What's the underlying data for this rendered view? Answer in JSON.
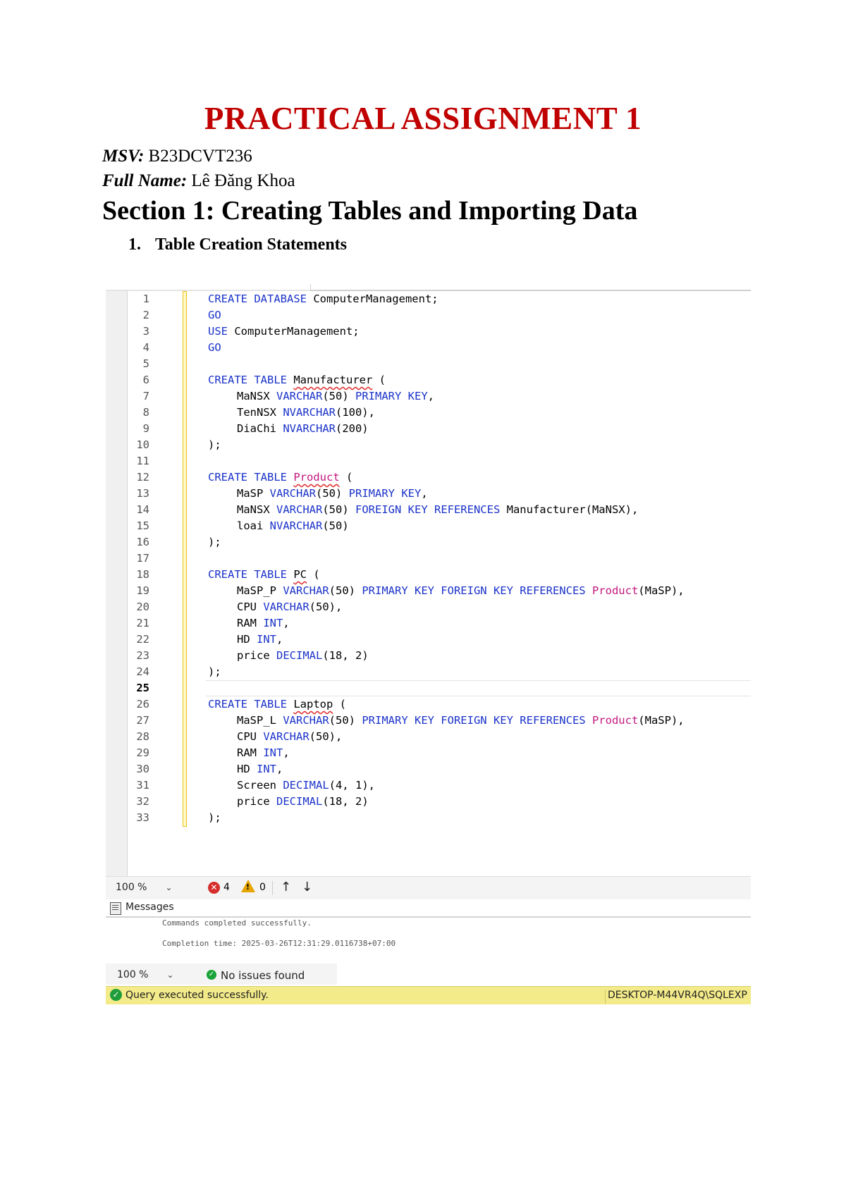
{
  "document": {
    "title": "PRACTICAL ASSIGNMENT 1",
    "msv_label": "MSV:",
    "msv_value": "B23DCVT236",
    "name_label": "Full Name:",
    "name_value": "Lê Đăng Khoa",
    "section_heading": "Section 1: Creating Tables and Importing Data",
    "list_number": "1.",
    "list_item": "Table Creation Statements"
  },
  "editor": {
    "current_line": 25,
    "lines": [
      {
        "n": "1",
        "indent": false,
        "tokens": [
          {
            "t": "CREATE DATABASE",
            "c": "kw"
          },
          {
            "t": " ComputerManagement;",
            "c": ""
          }
        ]
      },
      {
        "n": "2",
        "indent": false,
        "tokens": [
          {
            "t": "GO",
            "c": "kw"
          }
        ]
      },
      {
        "n": "3",
        "indent": false,
        "tokens": [
          {
            "t": "USE",
            "c": "kw"
          },
          {
            "t": " ComputerManagement;",
            "c": ""
          }
        ]
      },
      {
        "n": "4",
        "indent": false,
        "tokens": [
          {
            "t": "GO",
            "c": "kw"
          }
        ]
      },
      {
        "n": "5",
        "indent": false,
        "tokens": []
      },
      {
        "n": "6",
        "indent": false,
        "tokens": [
          {
            "t": "CREATE TABLE",
            "c": "kw"
          },
          {
            "t": " ",
            "c": ""
          },
          {
            "t": "Manufacturer",
            "c": "sq"
          },
          {
            "t": " (",
            "c": ""
          }
        ]
      },
      {
        "n": "7",
        "indent": true,
        "tokens": [
          {
            "t": "MaNSX ",
            "c": ""
          },
          {
            "t": "VARCHAR",
            "c": "kw"
          },
          {
            "t": "(50) ",
            "c": ""
          },
          {
            "t": "PRIMARY KEY",
            "c": "kw"
          },
          {
            "t": ",",
            "c": ""
          }
        ]
      },
      {
        "n": "8",
        "indent": true,
        "tokens": [
          {
            "t": "TenNSX ",
            "c": ""
          },
          {
            "t": "NVARCHAR",
            "c": "kw"
          },
          {
            "t": "(100),",
            "c": ""
          }
        ]
      },
      {
        "n": "9",
        "indent": true,
        "tokens": [
          {
            "t": "DiaChi ",
            "c": ""
          },
          {
            "t": "NVARCHAR",
            "c": "kw"
          },
          {
            "t": "(200)",
            "c": ""
          }
        ]
      },
      {
        "n": "10",
        "indent": false,
        "tokens": [
          {
            "t": ");",
            "c": ""
          }
        ]
      },
      {
        "n": "11",
        "indent": false,
        "tokens": []
      },
      {
        "n": "12",
        "indent": false,
        "tokens": [
          {
            "t": "CREATE TABLE",
            "c": "kw"
          },
          {
            "t": " ",
            "c": ""
          },
          {
            "t": "Product",
            "c": "fn sq"
          },
          {
            "t": " (",
            "c": ""
          }
        ]
      },
      {
        "n": "13",
        "indent": true,
        "tokens": [
          {
            "t": "MaSP ",
            "c": ""
          },
          {
            "t": "VARCHAR",
            "c": "kw"
          },
          {
            "t": "(50) ",
            "c": ""
          },
          {
            "t": "PRIMARY KEY",
            "c": "kw"
          },
          {
            "t": ",",
            "c": ""
          }
        ]
      },
      {
        "n": "14",
        "indent": true,
        "tokens": [
          {
            "t": "MaNSX ",
            "c": ""
          },
          {
            "t": "VARCHAR",
            "c": "kw"
          },
          {
            "t": "(50) ",
            "c": ""
          },
          {
            "t": "FOREIGN KEY REFERENCES",
            "c": "kw"
          },
          {
            "t": " Manufacturer(MaNSX),",
            "c": ""
          }
        ]
      },
      {
        "n": "15",
        "indent": true,
        "tokens": [
          {
            "t": "loai ",
            "c": ""
          },
          {
            "t": "NVARCHAR",
            "c": "kw"
          },
          {
            "t": "(50)",
            "c": ""
          }
        ]
      },
      {
        "n": "16",
        "indent": false,
        "tokens": [
          {
            "t": ");",
            "c": ""
          }
        ]
      },
      {
        "n": "17",
        "indent": false,
        "tokens": []
      },
      {
        "n": "18",
        "indent": false,
        "tokens": [
          {
            "t": "CREATE TABLE",
            "c": "kw"
          },
          {
            "t": " ",
            "c": ""
          },
          {
            "t": "PC",
            "c": "sq"
          },
          {
            "t": " (",
            "c": ""
          }
        ]
      },
      {
        "n": "19",
        "indent": true,
        "tokens": [
          {
            "t": "MaSP_P ",
            "c": ""
          },
          {
            "t": "VARCHAR",
            "c": "kw"
          },
          {
            "t": "(50) ",
            "c": ""
          },
          {
            "t": "PRIMARY KEY FOREIGN KEY REFERENCES",
            "c": "kw"
          },
          {
            "t": " ",
            "c": ""
          },
          {
            "t": "Product",
            "c": "fn"
          },
          {
            "t": "(MaSP),",
            "c": ""
          }
        ]
      },
      {
        "n": "20",
        "indent": true,
        "tokens": [
          {
            "t": "CPU ",
            "c": ""
          },
          {
            "t": "VARCHAR",
            "c": "kw"
          },
          {
            "t": "(50),",
            "c": ""
          }
        ]
      },
      {
        "n": "21",
        "indent": true,
        "tokens": [
          {
            "t": "RAM ",
            "c": ""
          },
          {
            "t": "INT",
            "c": "kw"
          },
          {
            "t": ",",
            "c": ""
          }
        ]
      },
      {
        "n": "22",
        "indent": true,
        "tokens": [
          {
            "t": "HD ",
            "c": ""
          },
          {
            "t": "INT",
            "c": "kw"
          },
          {
            "t": ",",
            "c": ""
          }
        ]
      },
      {
        "n": "23",
        "indent": true,
        "tokens": [
          {
            "t": "price ",
            "c": ""
          },
          {
            "t": "DECIMAL",
            "c": "kw"
          },
          {
            "t": "(18, 2)",
            "c": ""
          }
        ]
      },
      {
        "n": "24",
        "indent": false,
        "tokens": [
          {
            "t": ");",
            "c": ""
          }
        ]
      },
      {
        "n": "25",
        "indent": false,
        "tokens": []
      },
      {
        "n": "26",
        "indent": false,
        "tokens": [
          {
            "t": "CREATE TABLE",
            "c": "kw"
          },
          {
            "t": " ",
            "c": ""
          },
          {
            "t": "Laptop",
            "c": "sq"
          },
          {
            "t": " (",
            "c": ""
          }
        ]
      },
      {
        "n": "27",
        "indent": true,
        "tokens": [
          {
            "t": "MaSP_L ",
            "c": ""
          },
          {
            "t": "VARCHAR",
            "c": "kw"
          },
          {
            "t": "(50) ",
            "c": ""
          },
          {
            "t": "PRIMARY KEY FOREIGN KEY REFERENCES",
            "c": "kw"
          },
          {
            "t": " ",
            "c": ""
          },
          {
            "t": "Product",
            "c": "fn"
          },
          {
            "t": "(MaSP),",
            "c": ""
          }
        ]
      },
      {
        "n": "28",
        "indent": true,
        "tokens": [
          {
            "t": "CPU ",
            "c": ""
          },
          {
            "t": "VARCHAR",
            "c": "kw"
          },
          {
            "t": "(50),",
            "c": ""
          }
        ]
      },
      {
        "n": "29",
        "indent": true,
        "tokens": [
          {
            "t": "RAM ",
            "c": ""
          },
          {
            "t": "INT",
            "c": "kw"
          },
          {
            "t": ",",
            "c": ""
          }
        ]
      },
      {
        "n": "30",
        "indent": true,
        "tokens": [
          {
            "t": "HD ",
            "c": ""
          },
          {
            "t": "INT",
            "c": "kw"
          },
          {
            "t": ",",
            "c": ""
          }
        ]
      },
      {
        "n": "31",
        "indent": true,
        "tokens": [
          {
            "t": "Screen ",
            "c": ""
          },
          {
            "t": "DECIMAL",
            "c": "kw"
          },
          {
            "t": "(4, 1),",
            "c": ""
          }
        ]
      },
      {
        "n": "32",
        "indent": true,
        "tokens": [
          {
            "t": "price ",
            "c": ""
          },
          {
            "t": "DECIMAL",
            "c": "kw"
          },
          {
            "t": "(18, 2)",
            "c": ""
          }
        ]
      },
      {
        "n": "33",
        "indent": false,
        "tokens": [
          {
            "t": ");",
            "c": ""
          }
        ]
      }
    ]
  },
  "toolbar": {
    "zoom": "100 %",
    "errors": "4",
    "warnings": "0",
    "up_arrow": "↑",
    "down_arrow": "↓"
  },
  "messages": {
    "tab_label": "Messages",
    "line1": "Commands completed successfully.",
    "line2": "Completion time: 2025-03-26T12:31:29.0116738+07:00"
  },
  "issues_bar": {
    "zoom": "100 %",
    "text": "No issues found"
  },
  "status_bar": {
    "text": "Query executed successfully.",
    "server": "DESKTOP-M44VR4Q\\SQLEXP"
  },
  "colors": {
    "title": "#c00000",
    "keyword": "#1b33c9",
    "object": "#c2187e",
    "status_bar": "#f3ea8a"
  }
}
